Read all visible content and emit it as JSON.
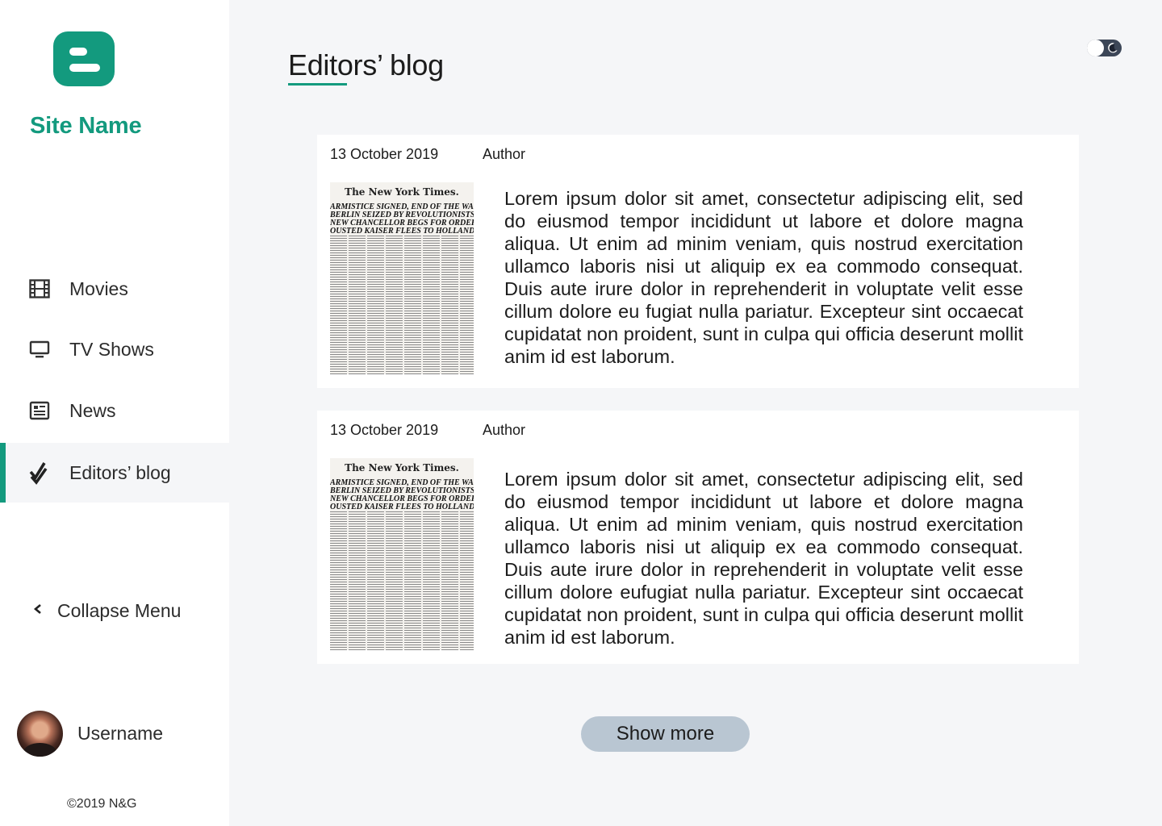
{
  "brand": {
    "site_name": "Site Name",
    "accent_color": "#139a7e"
  },
  "sidebar": {
    "items": [
      {
        "label": "Movies",
        "icon": "film-icon",
        "active": false
      },
      {
        "label": "TV Shows",
        "icon": "monitor-icon",
        "active": false
      },
      {
        "label": "News",
        "icon": "newspaper-icon",
        "active": false
      },
      {
        "label": "Editors’ blog",
        "icon": "double-check-icon",
        "active": true
      }
    ],
    "collapse_label": "Collapse Menu",
    "username": "Username",
    "copyright": "©2019 N&G"
  },
  "header": {
    "title": "Editors’ blog",
    "theme_toggle": {
      "mode": "dark",
      "icon": "moon-icon"
    }
  },
  "posts": [
    {
      "date": "13 October 2019",
      "author": "Author",
      "thumbnail": {
        "masthead": "The New York Times.",
        "headlines": [
          "ARMISTICE SIGNED, END OF THE WAR!",
          "BERLIN SEIZED BY REVOLUTIONISTS;",
          "NEW CHANCELLOR BEGS FOR ORDER;",
          "OUSTED KAISER FLEES TO HOLLAND"
        ]
      },
      "body": "Lorem ipsum dolor sit amet, consectetur adipiscing elit, sed do eiusmod tempor incididunt ut labore et dolore magna aliqua. Ut enim ad minim veniam, quis nostrud exercitation ullamco laboris nisi ut aliquip ex ea commodo consequat. Duis aute irure dolor in reprehenderit in voluptate velit esse cillum dolore eu fugiat nulla pariatur. Excepteur sint occaecat cupidatat non proident, sunt in culpa qui officia deserunt mollit anim id est laborum."
    },
    {
      "date": "13 October 2019",
      "author": "Author",
      "thumbnail": {
        "masthead": "The New York Times.",
        "headlines": [
          "ARMISTICE SIGNED, END OF THE WAR!",
          "BERLIN SEIZED BY REVOLUTIONISTS;",
          "NEW CHANCELLOR BEGS FOR ORDER;",
          "OUSTED KAISER FLEES TO HOLLAND"
        ]
      },
      "body": "Lorem ipsum dolor sit amet, consectetur adipiscing elit, sed do eiusmod tempor incididunt ut labore et dolore magna aliqua. Ut enim ad minim veniam, quis nostrud exercitation ullamco laboris nisi ut aliquip ex ea commodo consequat. Duis aute irure dolor in reprehenderit in voluptate velit esse cillum dolore eufugiat nulla pariatur. Excepteur sint occaecat cupidatat non proident, sunt in culpa qui officia deserunt mollit anim id est laborum."
    }
  ],
  "show_more_label": "Show more"
}
